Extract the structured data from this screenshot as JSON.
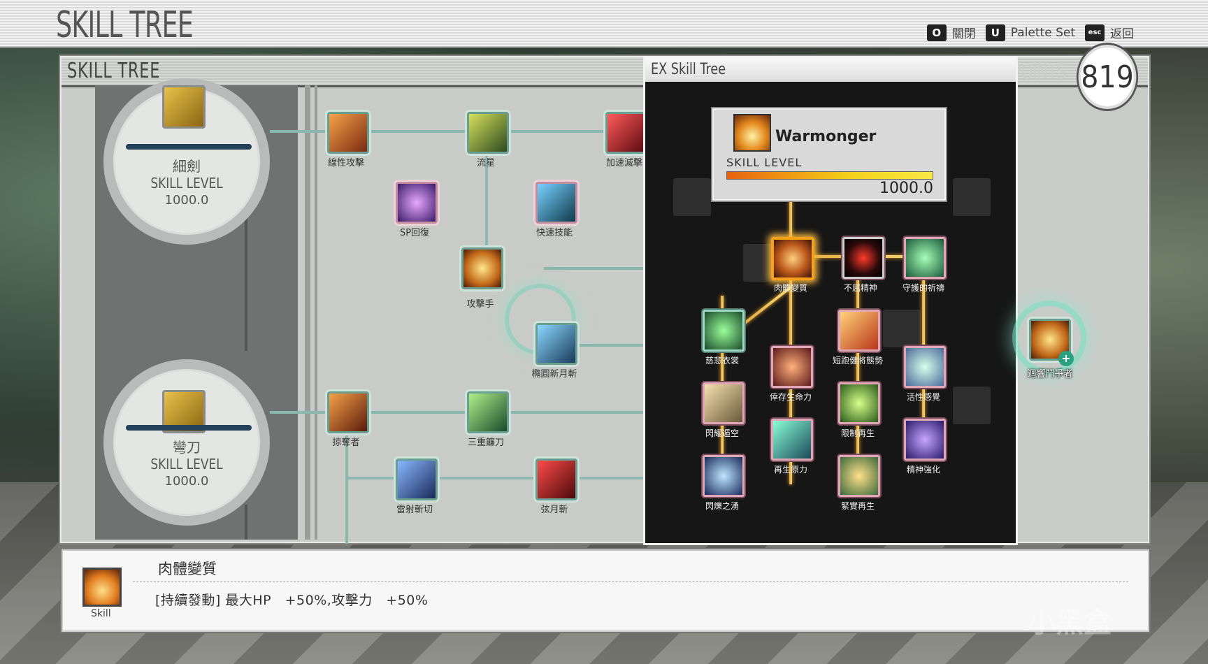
{
  "header": {
    "title": "SKILL TREE"
  },
  "hotkeys": [
    {
      "key": "O",
      "label": "關閉"
    },
    {
      "key": "U",
      "label": "Palette Set"
    },
    {
      "key": "esc",
      "label": "返回"
    }
  ],
  "panel": {
    "title": "SKILL TREE",
    "points_label": "POINTS",
    "points_value": "819"
  },
  "weapons": [
    {
      "name": "細劍",
      "level_label": "SKILL LEVEL",
      "level": "1000.0"
    },
    {
      "name": "彎刀",
      "level_label": "SKILL LEVEL",
      "level": "1000.0"
    }
  ],
  "tree_nodes": [
    "線性攻擊",
    "流星",
    "加速滅擊",
    "SP回復",
    "快速技能",
    "攻擊手",
    "橢圓新月斬",
    "掠奪者",
    "三重鐮刀",
    "雷射斬切",
    "弦月斬"
  ],
  "ex": {
    "title": "EX Skill Tree",
    "card": {
      "name": "Warmonger",
      "level_label": "SKILL LEVEL",
      "level": "1000.0",
      "progress": 1.0
    },
    "nodes": [
      "肉體變質",
      "不屈精神",
      "守護的祈禱",
      "慈悲衣裳",
      "短跑健將態勢",
      "倖存生命力",
      "活性感覺",
      "閃耀遁空",
      "限制再生",
      "再生原力",
      "精神強化",
      "閃爍之湧",
      "緊實再生"
    ]
  },
  "right_node": {
    "label": "迴響鬥爭者"
  },
  "description": {
    "icon_caption": "Skill",
    "name": "肉體變質",
    "text": "[持續發動] 最大HP　+50%,攻擊力　+50%"
  },
  "watermark": "小黑盒",
  "colors": {
    "accent_gold": "#f2b540",
    "panel_grey": "#c9cbc9",
    "ex_bg": "#161616"
  }
}
